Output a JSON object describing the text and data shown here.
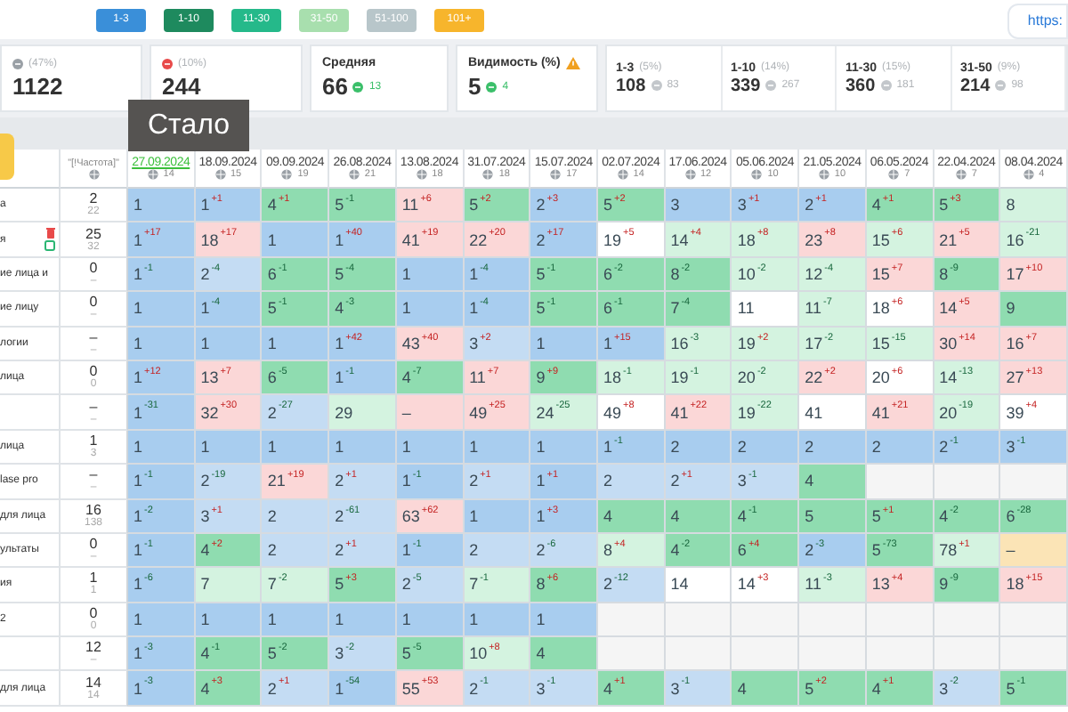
{
  "legend": [
    {
      "label": "1-3",
      "color": "#3a8fd9"
    },
    {
      "label": "1-10",
      "color": "#1e8a5e"
    },
    {
      "label": "11-30",
      "color": "#25b98a"
    },
    {
      "label": "31-50",
      "color": "#a8dfae"
    },
    {
      "label": "51-100",
      "color": "#b8c6ca"
    },
    {
      "label": "101+",
      "color": "#f7b52c"
    }
  ],
  "link": "https:",
  "summary": [
    {
      "kind": "plain",
      "share": "(47%)",
      "value": "1122"
    },
    {
      "kind": "plain",
      "share": "(10%)",
      "value": "244"
    },
    {
      "kind": "metric",
      "title": "Средняя",
      "value": "66",
      "change": "13",
      "warning": false
    },
    {
      "kind": "metric",
      "title": "Видимость (%)",
      "value": "5",
      "change": "4",
      "warning": true
    }
  ],
  "ranges": [
    {
      "label": "1-3",
      "share": "(5%)",
      "value": "108",
      "change": "83"
    },
    {
      "label": "1-10",
      "share": "(14%)",
      "value": "339",
      "change": "267"
    },
    {
      "label": "11-30",
      "share": "(15%)",
      "value": "360",
      "change": "181"
    },
    {
      "label": "31-50",
      "share": "(9%)",
      "value": "214",
      "change": "98"
    }
  ],
  "tooltip": "Стало",
  "table": {
    "frequency_header": "\"[!Частота]\"",
    "dates": [
      {
        "date": "27.09.2024",
        "count": "14",
        "highlighted": true
      },
      {
        "date": "18.09.2024",
        "count": "15",
        "highlighted": false
      },
      {
        "date": "09.09.2024",
        "count": "19",
        "highlighted": false
      },
      {
        "date": "26.08.2024",
        "count": "21",
        "highlighted": false
      },
      {
        "date": "13.08.2024",
        "count": "18",
        "highlighted": false
      },
      {
        "date": "31.07.2024",
        "count": "18",
        "highlighted": false
      },
      {
        "date": "15.07.2024",
        "count": "17",
        "highlighted": false
      },
      {
        "date": "02.07.2024",
        "count": "14",
        "highlighted": false
      },
      {
        "date": "17.06.2024",
        "count": "12",
        "highlighted": false
      },
      {
        "date": "05.06.2024",
        "count": "10",
        "highlighted": false
      },
      {
        "date": "21.05.2024",
        "count": "10",
        "highlighted": false
      },
      {
        "date": "06.05.2024",
        "count": "7",
        "highlighted": false
      },
      {
        "date": "22.04.2024",
        "count": "7",
        "highlighted": false
      },
      {
        "date": "08.04.2024",
        "count": "4",
        "highlighted": false
      }
    ],
    "rows": [
      {
        "keyword": "а",
        "icons": false,
        "freq": "2",
        "freq_sub": "22",
        "cells": [
          {
            "value": "1",
            "color": "#a8cdef"
          },
          {
            "value": "1",
            "delta": "+1",
            "color": "#a8cdef"
          },
          {
            "value": "4",
            "delta": "+1",
            "color": "#8fdcb0"
          },
          {
            "value": "5",
            "delta": "-1",
            "color": "#8fdcb0"
          },
          {
            "value": "11",
            "delta": "+6",
            "color": "#fbd7d7"
          },
          {
            "value": "5",
            "delta": "+2",
            "color": "#8fdcb0"
          },
          {
            "value": "2",
            "delta": "+3",
            "color": "#a8cdef"
          },
          {
            "value": "5",
            "delta": "+2",
            "color": "#8fdcb0"
          },
          {
            "value": "3",
            "color": "#a8cdef"
          },
          {
            "value": "3",
            "delta": "+1",
            "color": "#a8cdef"
          },
          {
            "value": "2",
            "delta": "+1",
            "color": "#a8cdef"
          },
          {
            "value": "4",
            "delta": "+1",
            "color": "#8fdcb0"
          },
          {
            "value": "5",
            "delta": "+3",
            "color": "#8fdcb0"
          },
          {
            "value": "8",
            "color": "#d4f3e0"
          }
        ]
      },
      {
        "keyword": "я",
        "icons": true,
        "freq": "25",
        "freq_sub": "32",
        "cells": [
          {
            "value": "1",
            "delta": "+17",
            "color": "#a8cdef"
          },
          {
            "value": "18",
            "delta": "+17",
            "color": "#fbd7d7"
          },
          {
            "value": "1",
            "color": "#a8cdef"
          },
          {
            "value": "1",
            "delta": "+40",
            "color": "#a8cdef"
          },
          {
            "value": "41",
            "delta": "+19",
            "color": "#fbd7d7"
          },
          {
            "value": "22",
            "delta": "+20",
            "color": "#fbd7d7"
          },
          {
            "value": "2",
            "delta": "+17",
            "color": "#a8cdef"
          },
          {
            "value": "19",
            "delta": "+5",
            "color": "#ffffff"
          },
          {
            "value": "14",
            "delta": "+4",
            "color": "#d4f3e0"
          },
          {
            "value": "18",
            "delta": "+8",
            "color": "#d4f3e0"
          },
          {
            "value": "23",
            "delta": "+8",
            "color": "#fbd7d7"
          },
          {
            "value": "15",
            "delta": "+6",
            "color": "#d4f3e0"
          },
          {
            "value": "21",
            "delta": "+5",
            "color": "#fbd7d7"
          },
          {
            "value": "16",
            "delta": "-21",
            "color": "#d4f3e0"
          }
        ]
      },
      {
        "keyword": "ие лица и",
        "icons": false,
        "freq": "0",
        "freq_sub": "–",
        "cells": [
          {
            "value": "1",
            "delta": "-1",
            "color": "#a8cdef"
          },
          {
            "value": "2",
            "delta": "-4",
            "color": "#c4dcf3"
          },
          {
            "value": "6",
            "delta": "-1",
            "color": "#8fdcb0"
          },
          {
            "value": "5",
            "delta": "-4",
            "color": "#8fdcb0"
          },
          {
            "value": "1",
            "color": "#a8cdef"
          },
          {
            "value": "1",
            "delta": "-4",
            "color": "#a8cdef"
          },
          {
            "value": "5",
            "delta": "-1",
            "color": "#8fdcb0"
          },
          {
            "value": "6",
            "delta": "-2",
            "color": "#8fdcb0"
          },
          {
            "value": "8",
            "delta": "-2",
            "color": "#8fdcb0"
          },
          {
            "value": "10",
            "delta": "-2",
            "color": "#d4f3e0"
          },
          {
            "value": "12",
            "delta": "-4",
            "color": "#d4f3e0"
          },
          {
            "value": "15",
            "delta": "+7",
            "color": "#fbd7d7"
          },
          {
            "value": "8",
            "delta": "-9",
            "color": "#8fdcb0"
          },
          {
            "value": "17",
            "delta": "+10",
            "color": "#fbd7d7"
          }
        ]
      },
      {
        "keyword": "ие лицу",
        "icons": false,
        "freq": "0",
        "freq_sub": "–",
        "cells": [
          {
            "value": "1",
            "color": "#a8cdef"
          },
          {
            "value": "1",
            "delta": "-4",
            "color": "#a8cdef"
          },
          {
            "value": "5",
            "delta": "-1",
            "color": "#8fdcb0"
          },
          {
            "value": "4",
            "delta": "-3",
            "color": "#8fdcb0"
          },
          {
            "value": "1",
            "color": "#a8cdef"
          },
          {
            "value": "1",
            "delta": "-4",
            "color": "#a8cdef"
          },
          {
            "value": "5",
            "delta": "-1",
            "color": "#8fdcb0"
          },
          {
            "value": "6",
            "delta": "-1",
            "color": "#8fdcb0"
          },
          {
            "value": "7",
            "delta": "-4",
            "color": "#8fdcb0"
          },
          {
            "value": "11",
            "color": "#ffffff"
          },
          {
            "value": "11",
            "delta": "-7",
            "color": "#d4f3e0"
          },
          {
            "value": "18",
            "delta": "+6",
            "color": "#ffffff"
          },
          {
            "value": "14",
            "delta": "+5",
            "color": "#fbd7d7"
          },
          {
            "value": "9",
            "color": "#8fdcb0"
          }
        ]
      },
      {
        "keyword": "логии",
        "icons": false,
        "freq": "–",
        "freq_sub": "–",
        "cells": [
          {
            "value": "1",
            "color": "#a8cdef"
          },
          {
            "value": "1",
            "color": "#a8cdef"
          },
          {
            "value": "1",
            "color": "#a8cdef"
          },
          {
            "value": "1",
            "delta": "+42",
            "color": "#a8cdef"
          },
          {
            "value": "43",
            "delta": "+40",
            "color": "#fbd7d7"
          },
          {
            "value": "3",
            "delta": "+2",
            "color": "#c4dcf3"
          },
          {
            "value": "1",
            "color": "#a8cdef"
          },
          {
            "value": "1",
            "delta": "+15",
            "color": "#a8cdef"
          },
          {
            "value": "16",
            "delta": "-3",
            "color": "#d4f3e0"
          },
          {
            "value": "19",
            "delta": "+2",
            "color": "#d4f3e0"
          },
          {
            "value": "17",
            "delta": "-2",
            "color": "#d4f3e0"
          },
          {
            "value": "15",
            "delta": "-15",
            "color": "#d4f3e0"
          },
          {
            "value": "30",
            "delta": "+14",
            "color": "#fbd7d7"
          },
          {
            "value": "16",
            "delta": "+7",
            "color": "#fbd7d7"
          }
        ]
      },
      {
        "keyword": "лица",
        "icons": false,
        "freq": "0",
        "freq_sub": "0",
        "cells": [
          {
            "value": "1",
            "delta": "+12",
            "color": "#a8cdef"
          },
          {
            "value": "13",
            "delta": "+7",
            "color": "#fbd7d7"
          },
          {
            "value": "6",
            "delta": "-5",
            "color": "#8fdcb0"
          },
          {
            "value": "1",
            "delta": "-1",
            "color": "#a8cdef"
          },
          {
            "value": "4",
            "delta": "-7",
            "color": "#8fdcb0"
          },
          {
            "value": "11",
            "delta": "+7",
            "color": "#fbd7d7"
          },
          {
            "value": "9",
            "delta": "+9",
            "color": "#8fdcb0"
          },
          {
            "value": "18",
            "delta": "-1",
            "color": "#d4f3e0"
          },
          {
            "value": "19",
            "delta": "-1",
            "color": "#d4f3e0"
          },
          {
            "value": "20",
            "delta": "-2",
            "color": "#d4f3e0"
          },
          {
            "value": "22",
            "delta": "+2",
            "color": "#fbd7d7"
          },
          {
            "value": "20",
            "delta": "+6",
            "color": "#ffffff"
          },
          {
            "value": "14",
            "delta": "-13",
            "color": "#d4f3e0"
          },
          {
            "value": "27",
            "delta": "+13",
            "color": "#fbd7d7"
          }
        ]
      },
      {
        "keyword": "",
        "icons": false,
        "freq": "–",
        "freq_sub": "–",
        "cells": [
          {
            "value": "1",
            "delta": "-31",
            "color": "#a8cdef"
          },
          {
            "value": "32",
            "delta": "+30",
            "color": "#fbd7d7"
          },
          {
            "value": "2",
            "delta": "-27",
            "color": "#c4dcf3"
          },
          {
            "value": "29",
            "color": "#d4f3e0"
          },
          {
            "value": "–",
            "color": "#fbd7d7"
          },
          {
            "value": "49",
            "delta": "+25",
            "color": "#fbd7d7"
          },
          {
            "value": "24",
            "delta": "-25",
            "color": "#d4f3e0"
          },
          {
            "value": "49",
            "delta": "+8",
            "color": "#ffffff"
          },
          {
            "value": "41",
            "delta": "+22",
            "color": "#fbd7d7"
          },
          {
            "value": "19",
            "delta": "-22",
            "color": "#d4f3e0"
          },
          {
            "value": "41",
            "color": "#ffffff"
          },
          {
            "value": "41",
            "delta": "+21",
            "color": "#fbd7d7"
          },
          {
            "value": "20",
            "delta": "-19",
            "color": "#d4f3e0"
          },
          {
            "value": "39",
            "delta": "+4",
            "color": "#ffffff"
          }
        ]
      },
      {
        "keyword": "лица",
        "icons": false,
        "freq": "1",
        "freq_sub": "3",
        "cells": [
          {
            "value": "1",
            "color": "#a8cdef"
          },
          {
            "value": "1",
            "color": "#a8cdef"
          },
          {
            "value": "1",
            "color": "#a8cdef"
          },
          {
            "value": "1",
            "color": "#a8cdef"
          },
          {
            "value": "1",
            "color": "#a8cdef"
          },
          {
            "value": "1",
            "color": "#a8cdef"
          },
          {
            "value": "1",
            "color": "#a8cdef"
          },
          {
            "value": "1",
            "delta": "-1",
            "color": "#a8cdef"
          },
          {
            "value": "2",
            "color": "#a8cdef"
          },
          {
            "value": "2",
            "color": "#a8cdef"
          },
          {
            "value": "2",
            "color": "#a8cdef"
          },
          {
            "value": "2",
            "color": "#a8cdef"
          },
          {
            "value": "2",
            "delta": "-1",
            "color": "#a8cdef"
          },
          {
            "value": "3",
            "delta": "-1",
            "color": "#a8cdef"
          }
        ]
      },
      {
        "keyword": "lase pro",
        "icons": false,
        "freq": "–",
        "freq_sub": "–",
        "cells": [
          {
            "value": "1",
            "delta": "-1",
            "color": "#a8cdef"
          },
          {
            "value": "2",
            "delta": "-19",
            "color": "#c4dcf3"
          },
          {
            "value": "21",
            "delta": "+19",
            "color": "#fbd7d7"
          },
          {
            "value": "2",
            "delta": "+1",
            "color": "#c4dcf3"
          },
          {
            "value": "1",
            "delta": "-1",
            "color": "#a8cdef"
          },
          {
            "value": "2",
            "delta": "+1",
            "color": "#c4dcf3"
          },
          {
            "value": "1",
            "delta": "+1",
            "color": "#a8cdef"
          },
          {
            "value": "2",
            "color": "#c4dcf3"
          },
          {
            "value": "2",
            "delta": "+1",
            "color": "#c4dcf3"
          },
          {
            "value": "3",
            "delta": "-1",
            "color": "#c4dcf3"
          },
          {
            "value": "4",
            "color": "#8fdcb0"
          },
          {
            "color": "#f5f5f5"
          },
          {
            "color": "#f5f5f5"
          },
          {
            "color": "#f5f5f5"
          }
        ]
      },
      {
        "keyword": "для лица",
        "icons": false,
        "freq": "16",
        "freq_sub": "138",
        "cells": [
          {
            "value": "1",
            "delta": "-2",
            "color": "#a8cdef"
          },
          {
            "value": "3",
            "delta": "+1",
            "color": "#c4dcf3"
          },
          {
            "value": "2",
            "color": "#c4dcf3"
          },
          {
            "value": "2",
            "delta": "-61",
            "color": "#c4dcf3"
          },
          {
            "value": "63",
            "delta": "+62",
            "color": "#fbd7d7"
          },
          {
            "value": "1",
            "color": "#a8cdef"
          },
          {
            "value": "1",
            "delta": "+3",
            "color": "#a8cdef"
          },
          {
            "value": "4",
            "color": "#8fdcb0"
          },
          {
            "value": "4",
            "color": "#8fdcb0"
          },
          {
            "value": "4",
            "delta": "-1",
            "color": "#8fdcb0"
          },
          {
            "value": "5",
            "color": "#8fdcb0"
          },
          {
            "value": "5",
            "delta": "+1",
            "color": "#8fdcb0"
          },
          {
            "value": "4",
            "delta": "-2",
            "color": "#8fdcb0"
          },
          {
            "value": "6",
            "delta": "-28",
            "color": "#8fdcb0"
          }
        ]
      },
      {
        "keyword": "ультаты",
        "icons": false,
        "freq": "0",
        "freq_sub": "–",
        "cells": [
          {
            "value": "1",
            "delta": "-1",
            "color": "#a8cdef"
          },
          {
            "value": "4",
            "delta": "+2",
            "color": "#8fdcb0"
          },
          {
            "value": "2",
            "color": "#c4dcf3"
          },
          {
            "value": "2",
            "delta": "+1",
            "color": "#c4dcf3"
          },
          {
            "value": "1",
            "delta": "-1",
            "color": "#a8cdef"
          },
          {
            "value": "2",
            "color": "#c4dcf3"
          },
          {
            "value": "2",
            "delta": "-6",
            "color": "#c4dcf3"
          },
          {
            "value": "8",
            "delta": "+4",
            "color": "#d4f3e0"
          },
          {
            "value": "4",
            "delta": "-2",
            "color": "#8fdcb0"
          },
          {
            "value": "6",
            "delta": "+4",
            "color": "#8fdcb0"
          },
          {
            "value": "2",
            "delta": "-3",
            "color": "#a8cdef"
          },
          {
            "value": "5",
            "delta": "-73",
            "color": "#8fdcb0"
          },
          {
            "value": "78",
            "delta": "+1",
            "color": "#d4f3e0"
          },
          {
            "value": "–",
            "color": "#fbe4b6"
          }
        ]
      },
      {
        "keyword": "ия",
        "icons": false,
        "freq": "1",
        "freq_sub": "1",
        "cells": [
          {
            "value": "1",
            "delta": "-6",
            "color": "#a8cdef"
          },
          {
            "value": "7",
            "color": "#d4f3e0"
          },
          {
            "value": "7",
            "delta": "-2",
            "color": "#d4f3e0"
          },
          {
            "value": "5",
            "delta": "+3",
            "color": "#8fdcb0"
          },
          {
            "value": "2",
            "delta": "-5",
            "color": "#c4dcf3"
          },
          {
            "value": "7",
            "delta": "-1",
            "color": "#d4f3e0"
          },
          {
            "value": "8",
            "delta": "+6",
            "color": "#8fdcb0"
          },
          {
            "value": "2",
            "delta": "-12",
            "color": "#c4dcf3"
          },
          {
            "value": "14",
            "color": "#ffffff"
          },
          {
            "value": "14",
            "delta": "+3",
            "color": "#ffffff"
          },
          {
            "value": "11",
            "delta": "-3",
            "color": "#d4f3e0"
          },
          {
            "value": "13",
            "delta": "+4",
            "color": "#fbd7d7"
          },
          {
            "value": "9",
            "delta": "-9",
            "color": "#8fdcb0"
          },
          {
            "value": "18",
            "delta": "+15",
            "color": "#fbd7d7"
          }
        ]
      },
      {
        "keyword": "2",
        "icons": false,
        "freq": "0",
        "freq_sub": "0",
        "cells": [
          {
            "value": "1",
            "color": "#a8cdef"
          },
          {
            "value": "1",
            "color": "#a8cdef"
          },
          {
            "value": "1",
            "color": "#a8cdef"
          },
          {
            "value": "1",
            "color": "#a8cdef"
          },
          {
            "value": "1",
            "color": "#a8cdef"
          },
          {
            "value": "1",
            "color": "#a8cdef"
          },
          {
            "value": "1",
            "color": "#a8cdef"
          },
          {
            "color": "#f5f5f5"
          },
          {
            "color": "#f5f5f5"
          },
          {
            "color": "#f5f5f5"
          },
          {
            "color": "#f5f5f5"
          },
          {
            "color": "#f5f5f5"
          },
          {
            "color": "#f5f5f5"
          },
          {
            "color": "#f5f5f5"
          }
        ]
      },
      {
        "keyword": "",
        "icons": false,
        "freq": "12",
        "freq_sub": "–",
        "cells": [
          {
            "value": "1",
            "delta": "-3",
            "color": "#a8cdef"
          },
          {
            "value": "4",
            "delta": "-1",
            "color": "#8fdcb0"
          },
          {
            "value": "5",
            "delta": "-2",
            "color": "#8fdcb0"
          },
          {
            "value": "3",
            "delta": "-2",
            "color": "#c4dcf3"
          },
          {
            "value": "5",
            "delta": "-5",
            "color": "#8fdcb0"
          },
          {
            "value": "10",
            "delta": "+8",
            "color": "#d4f3e0"
          },
          {
            "value": "4",
            "color": "#8fdcb0"
          },
          {
            "color": "#f5f5f5"
          },
          {
            "color": "#f5f5f5"
          },
          {
            "color": "#f5f5f5"
          },
          {
            "color": "#f5f5f5"
          },
          {
            "color": "#f5f5f5"
          },
          {
            "color": "#f5f5f5"
          },
          {
            "color": "#f5f5f5"
          }
        ]
      },
      {
        "keyword": "для лица",
        "icons": false,
        "freq": "14",
        "freq_sub": "14",
        "cells": [
          {
            "value": "1",
            "delta": "-3",
            "color": "#a8cdef"
          },
          {
            "value": "4",
            "delta": "+3",
            "color": "#8fdcb0"
          },
          {
            "value": "2",
            "delta": "+1",
            "color": "#c4dcf3"
          },
          {
            "value": "1",
            "delta": "-54",
            "color": "#a8cdef"
          },
          {
            "value": "55",
            "delta": "+53",
            "color": "#fbd7d7"
          },
          {
            "value": "2",
            "delta": "-1",
            "color": "#c4dcf3"
          },
          {
            "value": "3",
            "delta": "-1",
            "color": "#c4dcf3"
          },
          {
            "value": "4",
            "delta": "+1",
            "color": "#8fdcb0"
          },
          {
            "value": "3",
            "delta": "-1",
            "color": "#c4dcf3"
          },
          {
            "value": "4",
            "color": "#8fdcb0"
          },
          {
            "value": "5",
            "delta": "+2",
            "color": "#8fdcb0"
          },
          {
            "value": "4",
            "delta": "+1",
            "color": "#8fdcb0"
          },
          {
            "value": "3",
            "delta": "-2",
            "color": "#c4dcf3"
          },
          {
            "value": "5",
            "delta": "-1",
            "color": "#8fdcb0"
          }
        ]
      }
    ]
  }
}
